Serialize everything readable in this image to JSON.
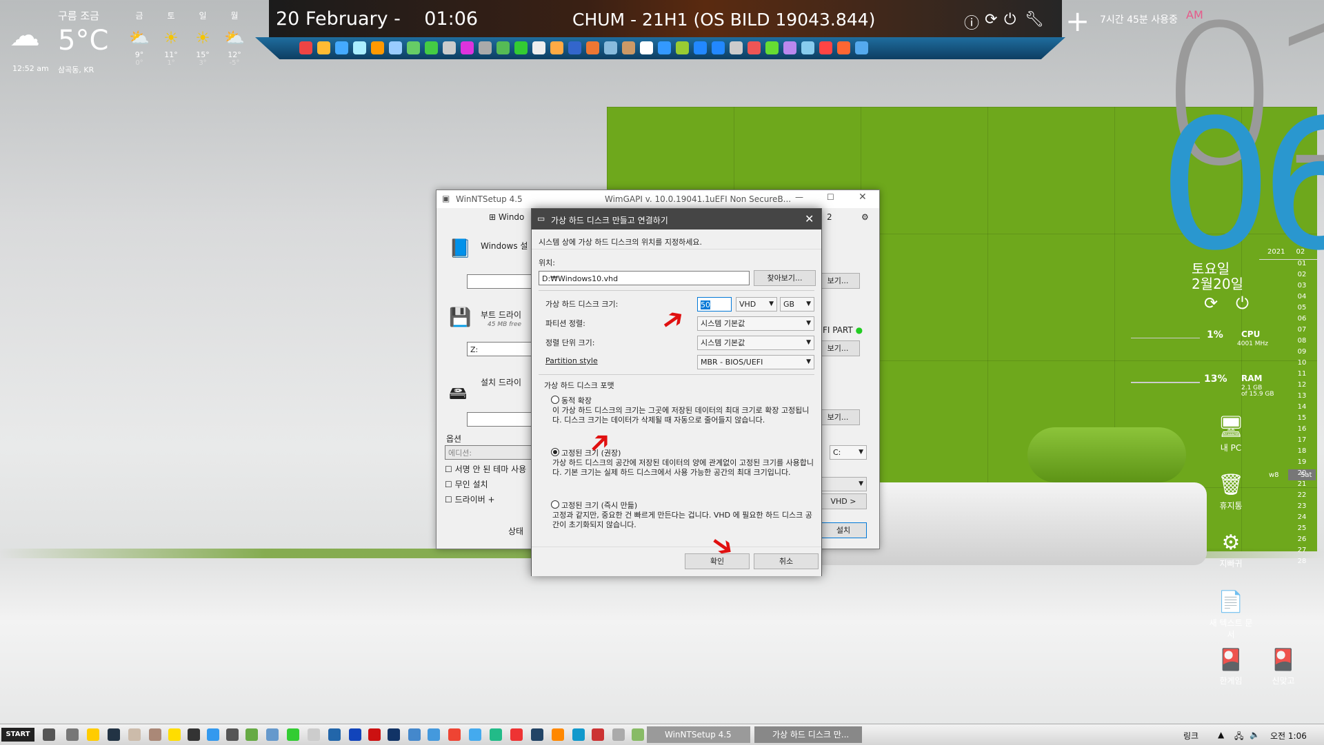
{
  "weather": {
    "condition": "구름 조금",
    "temp": "5°C",
    "time": "12:52 am",
    "location": "삼곡동, KR",
    "forecast": [
      {
        "day": "금",
        "hi": "9°",
        "lo": "0°",
        "icon": "partly-cloudy-icon"
      },
      {
        "day": "토",
        "hi": "11°",
        "lo": "1°",
        "icon": "sun-icon"
      },
      {
        "day": "일",
        "hi": "15°",
        "lo": "3°",
        "icon": "sun-icon"
      },
      {
        "day": "월",
        "hi": "12°",
        "lo": "-5°",
        "icon": "partly-cloudy-icon"
      }
    ]
  },
  "topbar": {
    "date": "20 February -",
    "time": "01:06",
    "title": "CHUM - 21H1 (OS BILD 19043.844)"
  },
  "clock": {
    "uptime": "7시간 45분 사용중",
    "ampm": "AM",
    "hour": "01",
    "minute": "06",
    "day_name": "토요일",
    "date": "2월20일"
  },
  "calendar": {
    "year": "2021",
    "month": "02",
    "week": "w8",
    "today_label": "Sat",
    "days": [
      "01",
      "02",
      "03",
      "04",
      "05",
      "06",
      "07",
      "08",
      "09",
      "10",
      "11",
      "12",
      "13",
      "14",
      "15",
      "16",
      "17",
      "18",
      "19",
      "20",
      "21",
      "22",
      "23",
      "24",
      "25",
      "26",
      "27",
      "28"
    ],
    "today": "20"
  },
  "system": {
    "cpu_pct": "1%",
    "cpu_label": "CPU",
    "cpu_freq": "4001 MHz",
    "ram_pct": "13%",
    "ram_label": "RAM",
    "ram_used": "2.1 GB",
    "ram_total": "of 15.9 GB"
  },
  "desktop_icons": [
    "내 PC",
    "휴지통",
    "지빠귀",
    "새 텍스트 문서",
    "한게임",
    "신맞고"
  ],
  "back_window": {
    "title": "WinNTSetup 4.5",
    "wimgapi": "WimGAPI v. 10.0.19041.1",
    "mode": "uEFI Non SecureB...",
    "tab": "Windo",
    "sec1": "Windows 설",
    "sec2": "부트 드라이",
    "sec2_sub": "45 MB free",
    "sec2_drive": "Z:",
    "sec3": "설치 드라이",
    "options": "옵션",
    "edition": "에디션:",
    "opt1": "서명 안 된 테마 사용",
    "opt2": "무인 설치",
    "opt3": "드라이버 +",
    "status": "상태",
    "efi": "FI PART",
    "browse": "보기...",
    "drive_c": "C:",
    "vhd": "VHD >",
    "install": "설치",
    "num": "2"
  },
  "dialog": {
    "title": "가상 하드 디스크 만들고 연결하기",
    "instruction": "시스템 상에 가상 하드 디스크의 위치를 지정하세요.",
    "location_label": "위치:",
    "location_value": "D:₩Windows10.vhd",
    "browse_button": "찾아보기...",
    "size_label": "가상 하드 디스크 크기:",
    "size_value": "50",
    "size_type": "VHD",
    "size_unit": "GB",
    "partition_align_label": "파티션 정렬:",
    "partition_align_value": "시스템 기본값",
    "align_unit_label": "정렬 단위 크기:",
    "align_unit_value": "시스템 기본값",
    "partition_style_label": "Partition style",
    "partition_style_value": "MBR - BIOS/UEFI",
    "format_group": "가상 하드 디스크 포맷",
    "opt_dynamic": "동적 확장",
    "opt_dynamic_desc": "이 가상 하드 디스크의 크기는 그곳에 저장된 데이터의 최대 크기로 확장 고정됩니다. 디스크 크기는 데이터가 삭제될 때 자동으로 줄어들지 않습니다.",
    "opt_fixed": "고정된 크기 (권장)",
    "opt_fixed_desc": "가상 하드 디스크의 공간에 저장된 데이터의 양에 관계없이 고정된 크기를 사용합니다. 기본 크기는 실제 하드 디스크에서 사용 가능한 공간의 최대 크기입니다.",
    "opt_fixed_fast": "고정된 크기 (즉시 만듦)",
    "opt_fixed_fast_desc": "고정과 같지만, 중요한 건 빠르게 만든다는 겁니다. VHD 에 필요한 하드 디스크 공간이 초기화되지 않습니다.",
    "ok_button": "확인",
    "cancel_button": "취소"
  },
  "taskbar": {
    "start": "START",
    "task1": "WinNTSetup 4.5",
    "task2": "가상 하드 디스크 만...",
    "links": "링크",
    "clock": "오전 1:06"
  },
  "colors": {
    "accent_blue": "#2a97cf",
    "wall_green": "#6ea81c",
    "arrow_red": "#e01010"
  }
}
